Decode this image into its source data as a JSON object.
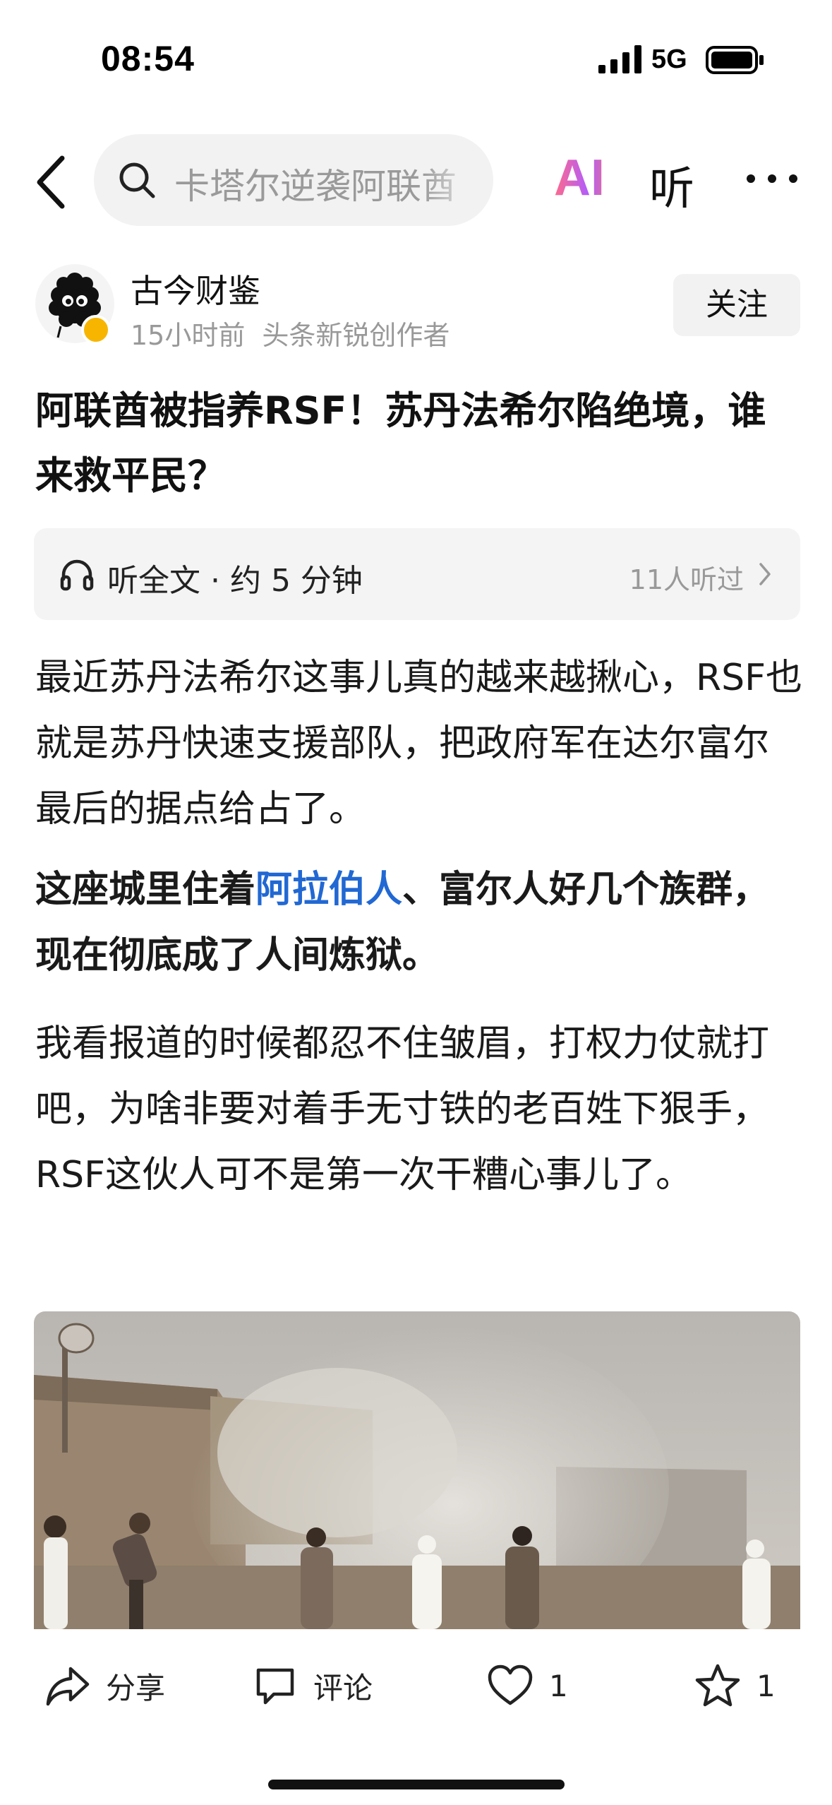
{
  "status_bar": {
    "time": "08:54",
    "network": "5G"
  },
  "nav": {
    "search_text": "卡塔尔逆袭阿联酋",
    "ai_label": "AI",
    "listen_label": "听",
    "icons": [
      "back-icon",
      "search-icon",
      "more-icon"
    ]
  },
  "author": {
    "name": "古今财鉴",
    "time": "15小时前",
    "tag": "头条新锐创作者",
    "follow_label": "关注"
  },
  "article": {
    "title": "阿联酋被指养RSF！苏丹法希尔陷绝境，谁来救平民？",
    "listen_full": "听全文 · 约 5 分钟",
    "listen_count": "11人听过",
    "paragraphs": {
      "p1": "最近苏丹法希尔这事儿真的越来越揪心，RSF也就是苏丹快速支援部队，把政府军在达尔富尔最后的据点给占了。",
      "p2_before": "这座城里住着",
      "p2_link": "阿拉伯人",
      "p2_after": "、富尔人好几个族群，现在彻底成了人间炼狱。",
      "p3": "我看报道的时候都忍不住皱眉，打权力仗就打吧，为啥非要对着手无寸铁的老百姓下狠手，RSF这伙人可不是第一次干糟心事儿了。"
    }
  },
  "actions": {
    "share_label": "分享",
    "comment_label": "评论",
    "like_count": "1",
    "favorite_count": "1"
  },
  "colors": {
    "link": "#2168d3",
    "badge": "#f7b500",
    "muted": "#999999"
  }
}
